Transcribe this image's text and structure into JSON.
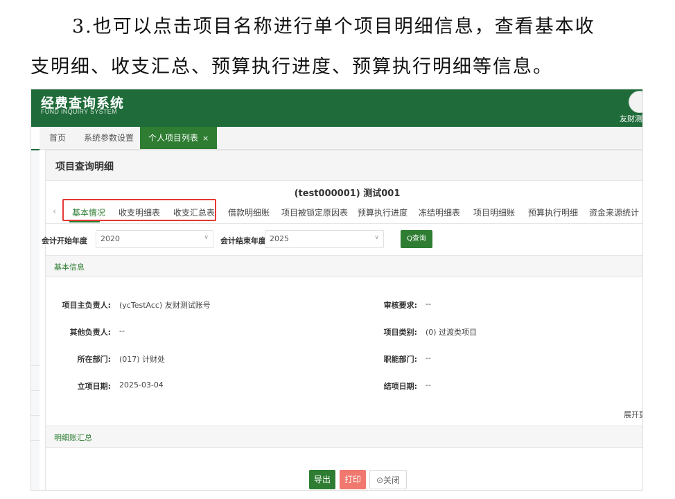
{
  "doc": {
    "line1": "3.也可以点击项目名称进行单个项目明细信息，查看基本收",
    "line2": "支明细、收支汇总、预算执行进度、预算执行明细等信息。"
  },
  "app": {
    "title": "经费查询系统",
    "subtitle": "FUND INQUIRY SYSTEM",
    "user": "友财测"
  },
  "page_tabs": {
    "home": "首页",
    "sys_params": "系统参数设置",
    "active": "个人项目列表",
    "close_glyph": "×"
  },
  "panel": {
    "title": "项目查询明细",
    "project_title": "(test000001) 测试001",
    "prev_glyph": "‹",
    "tabs": [
      "基本情况",
      "收支明细表",
      "收支汇总表",
      "借款明细账",
      "项目被锁定原因表",
      "预算执行进度",
      "冻结明细表",
      "项目明细账",
      "预算执行明细",
      "资金来源统计"
    ]
  },
  "filters": {
    "start_label": "会计开始年度",
    "start_value": "2020",
    "end_label": "会计结束年度",
    "end_value": "2025",
    "query_label": "Q查询",
    "caret_glyph": "∨"
  },
  "basic": {
    "section_title": "基本信息",
    "fields": [
      {
        "label": "项目主负责人:",
        "value": "(ycTestAcc) 友财测试账号"
      },
      {
        "label": "审核要求:",
        "value": "--"
      },
      {
        "label": "其他负责人:",
        "value": "--"
      },
      {
        "label": "项目类别:",
        "value": "(0) 过渡类项目"
      },
      {
        "label": "所在部门:",
        "value": "(017) 计财处"
      },
      {
        "label": "职能部门:",
        "value": "--"
      },
      {
        "label": "立项日期:",
        "value": "2025-03-04"
      },
      {
        "label": "结项日期:",
        "value": "--"
      }
    ],
    "expand": "展开更"
  },
  "ledger": {
    "section_title": "明细账汇总"
  },
  "buttons": {
    "export": "导出",
    "print": "打印",
    "close": "⊙关闭"
  },
  "colors": {
    "brand_green": "#1f6b3a",
    "accent_green": "#2e7d32",
    "highlight_red": "#e53935",
    "print_red": "#f0786e"
  }
}
